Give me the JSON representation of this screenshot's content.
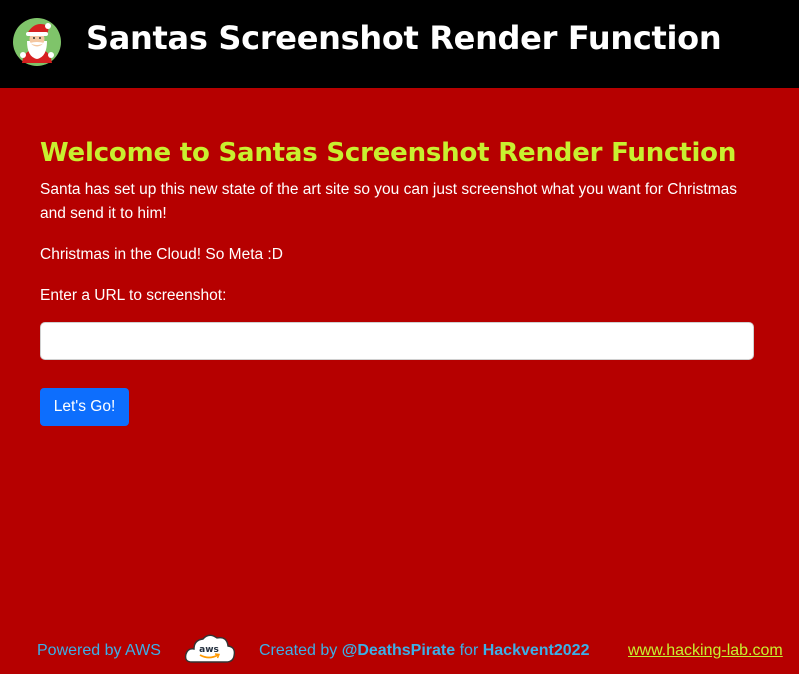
{
  "header": {
    "title": "Santas Screenshot Render Function",
    "logo_icon": "santa-avatar-icon"
  },
  "main": {
    "heading": "Welcome to Santas Screenshot Render Function",
    "intro": "Santa has set up this new state of the art site so you can just screenshot what you want for Christmas and send it to him!",
    "tagline": "Christmas in the Cloud! So Meta :D",
    "url_label": "Enter a URL to screenshot:",
    "url_value": "",
    "url_placeholder": "",
    "submit_label": "Let's Go!"
  },
  "footer": {
    "powered_by": "Powered by AWS",
    "aws_icon": "aws-cloud-icon",
    "aws_logo_text": "aws",
    "created_prefix": "Created by",
    "author": "@DeathsPirate",
    "for_text": "for",
    "event": "Hackvent2022",
    "link_text": "www.hacking-lab.com"
  },
  "colors": {
    "page_background": "#b60000",
    "header_background": "#000000",
    "heading": "#c8f02f",
    "footer_text": "#3bb0e8",
    "button": "#0d6efd"
  }
}
